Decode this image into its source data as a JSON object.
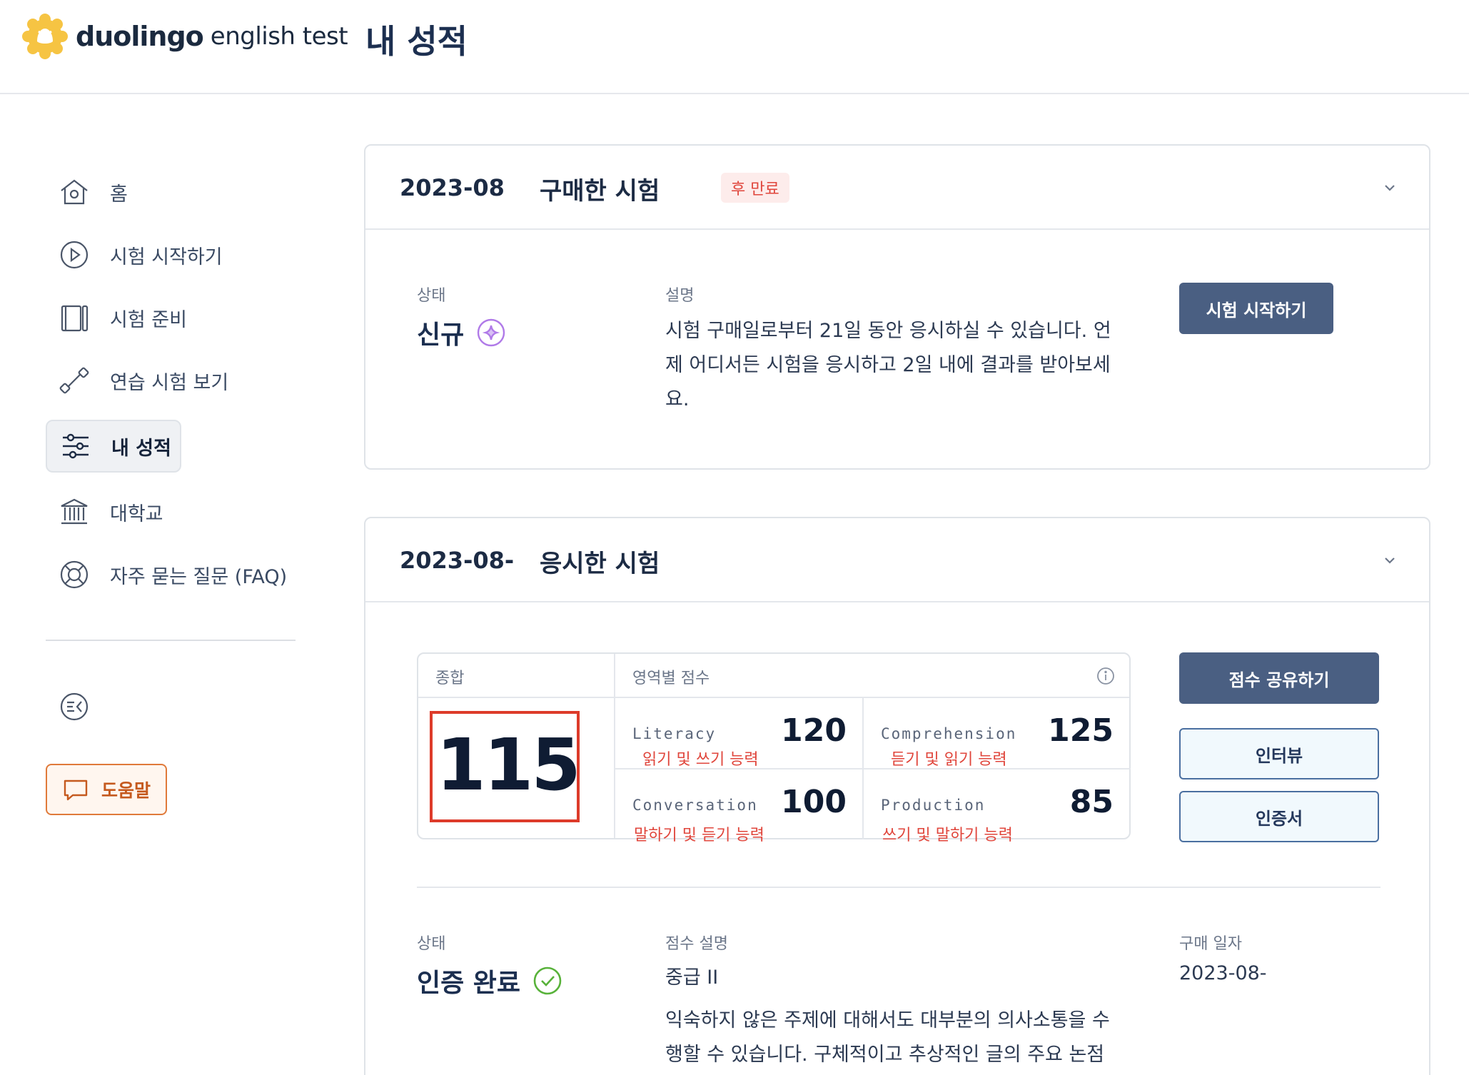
{
  "header": {
    "brand_word": "duolingo",
    "brand_sub": "english test",
    "page_title": "내 성적"
  },
  "sidebar": {
    "items": [
      {
        "label": "홈",
        "icon": "home-icon"
      },
      {
        "label": "시험 시작하기",
        "icon": "play-circle-icon"
      },
      {
        "label": "시험 준비",
        "icon": "book-icon"
      },
      {
        "label": "연습 시험 보기",
        "icon": "dumbbell-icon"
      },
      {
        "label": "내 성적",
        "icon": "sliders-icon"
      },
      {
        "label": "대학교",
        "icon": "university-icon"
      },
      {
        "label": "자주 묻는 질문 (FAQ)",
        "icon": "lifebuoy-icon"
      }
    ],
    "active_index": 4,
    "collapse_icon": "collapse-sidebar-icon",
    "help_label": "도움말"
  },
  "purchased": {
    "date": "2023-08",
    "title": "구매한 시험",
    "badge": "후 만료",
    "status_label": "상태",
    "status_value": "신규",
    "desc_label": "설명",
    "desc_lines": [
      "시험 구매일로부터 21일 동안 응시하실 수 있습니다. 언",
      "제 어디서든 시험을 응시하고 2일 내에 결과를 받아보세",
      "요."
    ],
    "start_button": "시험 시작하기"
  },
  "taken": {
    "date": "2023-08-",
    "title": "응시한 시험",
    "overall_header": "종합",
    "subscores_header": "영역별 점수",
    "overall_score": "115",
    "subscores": [
      {
        "name": "Literacy",
        "score": "120",
        "note": "읽기 및 쓰기 능력"
      },
      {
        "name": "Comprehension",
        "score": "125",
        "note": "듣기 및 읽기 능력"
      },
      {
        "name": "Conversation",
        "score": "100",
        "note": "말하기 및 듣기 능력"
      },
      {
        "name": "Production",
        "score": "85",
        "note": "쓰기 및 말하기 능력"
      }
    ],
    "share_button": "점수 공유하기",
    "interview_button": "인터뷰",
    "certificate_button": "인증서",
    "status_label": "상태",
    "status_value": "인증 완료",
    "score_desc_label": "점수 설명",
    "score_level": "중급 II",
    "score_desc_lines": [
      "익숙하지 않은 주제에 대해서도 대부분의 의사소통을 수",
      "행할 수 있습니다. 구체적이고 추상적인 글의 주요 논점"
    ],
    "purchase_date_label": "구매 일자",
    "purchase_date": "2023-08-"
  },
  "colors": {
    "primary_button": "#4a5f82",
    "badge_red": "#e0463c",
    "help_orange": "#e07a3a",
    "logo_yellow": "#f6c443",
    "verified_green": "#58b23a",
    "new_purple": "#b07ae8"
  }
}
